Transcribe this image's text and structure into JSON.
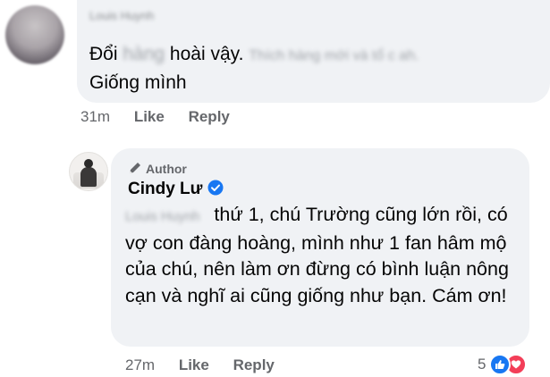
{
  "comment1": {
    "author_name": "Louis Huynh",
    "line1_start": "Đổi",
    "line1_blur1": "hàng",
    "line1_mid": "hoài vậy.",
    "line1_blur2": "Thích hàng mới và tổ c ah.",
    "line2": "Giống mình",
    "time": "31m",
    "like_label": "Like",
    "reply_label": "Reply"
  },
  "comment2": {
    "badge": "Author",
    "author_name": "Cindy Lư",
    "mention": "Louis Huynh",
    "text": "thứ 1, chú Trường cũng lớn rồi, có vợ con đàng hoàng, mình như 1 fan hâm mộ của chú, nên làm ơn đừng có bình luận nông cạn và nghĩ ai cũng giống như bạn. Cám ơn!",
    "time": "27m",
    "like_label": "Like",
    "reply_label": "Reply",
    "reaction_count": "5"
  },
  "colors": {
    "bubble": "#f0f2f5",
    "text": "#050505",
    "secondary": "#65676b",
    "facebook_blue": "#1877f2",
    "love_red": "#f33e58"
  },
  "icons": {
    "author_badge": "pen-icon",
    "verified": "verified-badge-icon",
    "reactions": [
      "like-reaction-icon",
      "love-reaction-icon"
    ]
  }
}
